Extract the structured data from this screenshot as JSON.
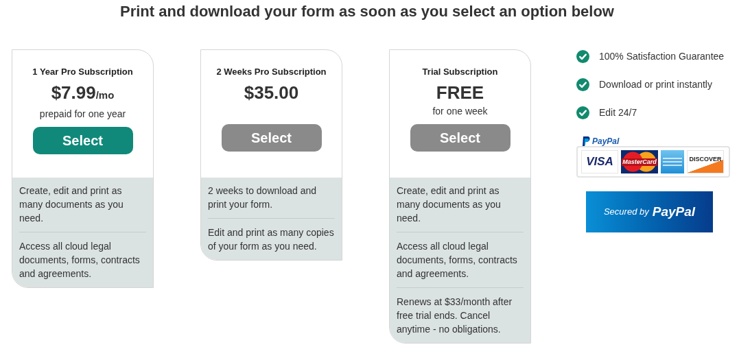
{
  "heading": "Print and download your form as soon as you select an option below",
  "plans": [
    {
      "title": "1 Year Pro Subscription",
      "price": "$7.99",
      "unit": "/mo",
      "note": "prepaid for one year",
      "button": "Select",
      "selected": true,
      "features": [
        "Create, edit and print as many documents as you need.",
        "Access all cloud legal documents, forms, contracts and agreements."
      ]
    },
    {
      "title": "2 Weeks Pro Subscription",
      "price": "$35.00",
      "button": "Select",
      "selected": false,
      "features": [
        "2 weeks to download and print your form.",
        "Edit and print as many copies of your form as you need."
      ]
    },
    {
      "title": "Trial Subscription",
      "price": "FREE",
      "note": "for one week",
      "button": "Select",
      "selected": false,
      "features": [
        "Create, edit and print as many documents as you need.",
        "Access all cloud legal documents, forms, contracts and agreements.",
        "Renews at $33/month after free trial ends. Cancel anytime - no obligations."
      ]
    }
  ],
  "benefits": [
    "100% Satisfaction Guarantee",
    "Download or print instantly",
    "Edit 24/7"
  ],
  "payment": {
    "brand": "PayPal",
    "cards": [
      {
        "kind": "visa",
        "label": "VISA"
      },
      {
        "kind": "mastercard",
        "label": "MasterCard"
      },
      {
        "kind": "amex"
      },
      {
        "kind": "discover",
        "label": "DISCOVER"
      }
    ]
  },
  "secured": {
    "prefix": "Secured by",
    "brand": "PayPal"
  }
}
